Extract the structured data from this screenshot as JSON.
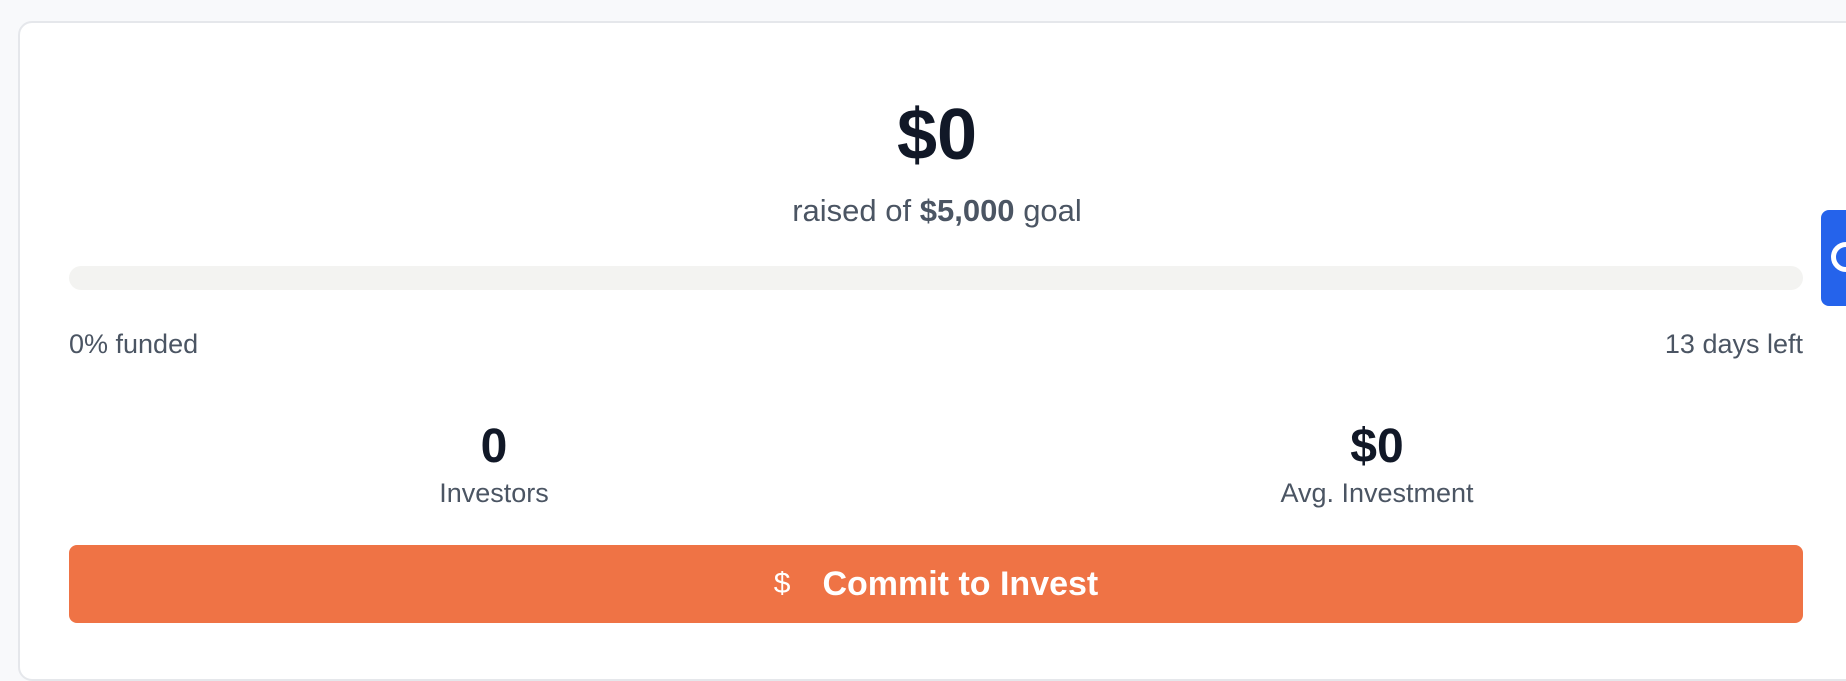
{
  "summary": {
    "amount_raised": "$0",
    "goal_prefix": "raised of",
    "goal_amount": "$5,000",
    "goal_suffix": "goal"
  },
  "progress": {
    "funded_fraction": 0,
    "funded_label": "0% funded",
    "days_left_label": "13 days left"
  },
  "stats": {
    "investors": {
      "value": "0",
      "label": "Investors"
    },
    "avg_investment": {
      "value": "$0",
      "label": "Avg. Investment"
    }
  },
  "cta": {
    "icon": "dollar-icon",
    "icon_glyph": "$",
    "label": "Commit to Invest"
  },
  "side_tab": {
    "icon": "chat-icon"
  },
  "colors": {
    "accent": "#ef7345",
    "side_tab": "#2563eb",
    "heading": "#111827",
    "muted": "#4b5563",
    "track": "#f3f3f1"
  }
}
